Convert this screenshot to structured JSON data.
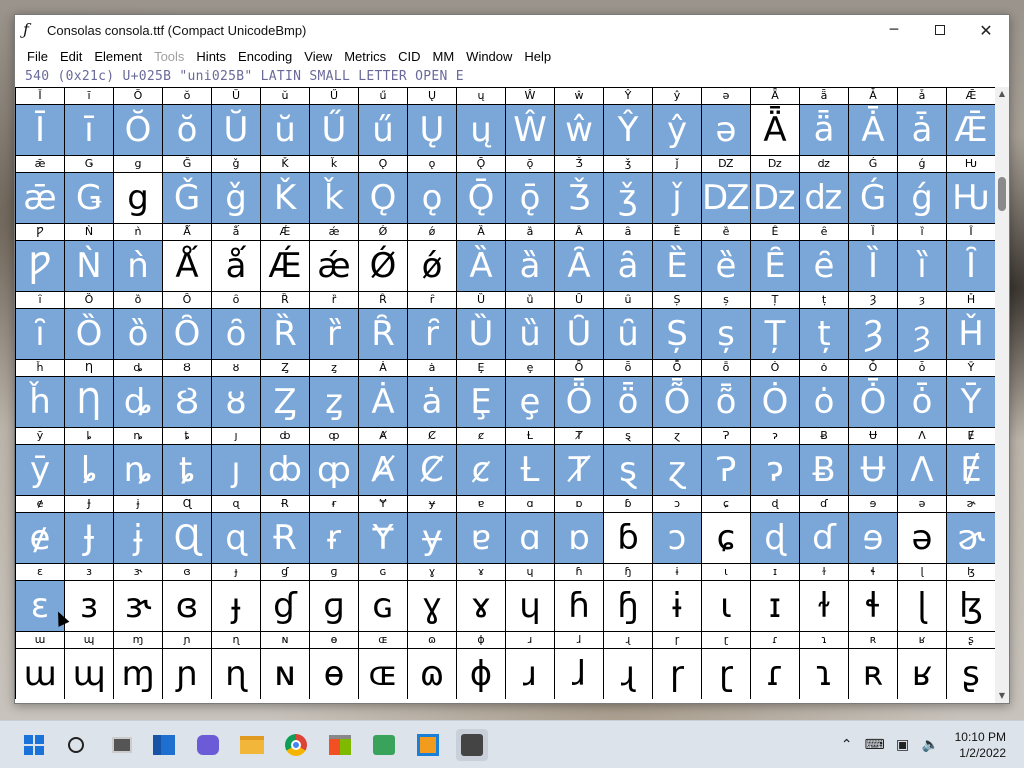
{
  "window": {
    "title": "Consolas  consola.ttf (Compact UnicodeBmp)",
    "app_icon": "ƒ"
  },
  "menu": [
    {
      "label": "File",
      "enabled": true
    },
    {
      "label": "Edit",
      "enabled": true
    },
    {
      "label": "Element",
      "enabled": true
    },
    {
      "label": "Tools",
      "enabled": false
    },
    {
      "label": "Hints",
      "enabled": true
    },
    {
      "label": "Encoding",
      "enabled": true
    },
    {
      "label": "View",
      "enabled": true
    },
    {
      "label": "Metrics",
      "enabled": true
    },
    {
      "label": "CID",
      "enabled": true
    },
    {
      "label": "MM",
      "enabled": true
    },
    {
      "label": "Window",
      "enabled": true
    },
    {
      "label": "Help",
      "enabled": true
    }
  ],
  "info_line": "540 (0x21c) U+025B \"uni025B\" LATIN SMALL LETTER OPEN E",
  "glyph_rows": [
    {
      "glyphs": "ĪīŎŏŬŭŰűŲųŴŵŶŷəǞǟǠǡǢ",
      "selected": "11111111111111101111"
    },
    {
      "glyphs": "ǣǤgǦǧǨǩǪǫǬǭǮǯǰǱǲǳǴǵǶ",
      "selected": "11011111111111111111"
    },
    {
      "glyphs": "ǷǸǹǺǻǼǽǾǿȀȁȂȃȄȅȆȇȈȉȊ",
      "selected": "11100000011111111111"
    },
    {
      "glyphs": "ȋȌȍȎȏȐȑȒȓȔȕȖȗȘșȚțȜȝȞ",
      "selected": "11111111111111111111"
    },
    {
      "glyphs": "ȟȠȡȢȣȤȥȦȧȨȩȪȫȬȭȮȯȰȱȲ",
      "selected": "11111111111111111111"
    },
    {
      "glyphs": "ȳȴȵȶȷȸȹȺȻȼȽȾȿɀɁɂɃɄɅɆ",
      "selected": "11111111111111111111"
    },
    {
      "glyphs": "ɇɈɉɊɋɌɍɎɏɐɑɒɓɔɕɖɗɘəɚ",
      "selected": "11111111111101011101"
    },
    {
      "glyphs": "ɛɜɝɞɟɠɡɢɣɤɥɦɧɨɩɪɫɬɭɮ",
      "selected": "10000000000000000000"
    },
    {
      "glyphs": "ɯɰɱɲɳɴɵɶɷɸɹɺɻɼɽɾɿʀʁʂ",
      "selected": "00000000000000000000"
    }
  ],
  "taskbar": {
    "icons": [
      "windows-start",
      "search",
      "task-view",
      "widgets",
      "teams-chat",
      "file-explorer",
      "chrome",
      "microsoft-store",
      "app-green",
      "app-blue-orange",
      "fontforge"
    ],
    "time": "10:10 PM",
    "date": "1/2/2022"
  }
}
